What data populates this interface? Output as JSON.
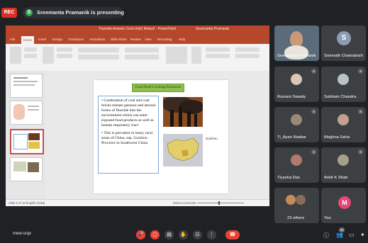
{
  "meet": {
    "rec_label": "REC",
    "presenter_initial": "S",
    "presenting_text": "Sreemanta Pramanik is presenting",
    "meeting_code": "mew-srqx"
  },
  "powerpoint": {
    "title_bar": "Fluoride-Arsenic Cont-Unit1 Notes2 - PowerPoint",
    "user": "Sreemanta Pramanik",
    "tabs": [
      "File",
      "Home",
      "Insert",
      "Design",
      "Transitions",
      "Animations",
      "Slide Show",
      "Review",
      "View",
      "Recording",
      "Help"
    ],
    "slide": {
      "title": "Coal-fired Cocking Emission",
      "bullets": [
        "• Combustion of coal and coal bricks release gaseous and aerosol forms of fluoride into the environment which can enter exposed food products as well as human respiratory tract",
        "• This is prevalent in many rural areas of China, esp. Guizhou Province in Southwest China"
      ],
      "map_label": "Guizhou"
    },
    "status_left": "Slide 5 of 18   English (India)",
    "status_right": "Notes   Comments"
  },
  "participants": [
    {
      "name": "Sreemanta Pramanik",
      "type": "camera"
    },
    {
      "name": "Somnath Chakraborti",
      "type": "avatar",
      "initial": "S",
      "color": "#8e9bb5"
    },
    {
      "name": "Rumani Swasty",
      "type": "photo"
    },
    {
      "name": "Subham Chandra",
      "type": "photo"
    },
    {
      "name": "Ti_Ayan Naskar",
      "type": "photo"
    },
    {
      "name": "Meghna Saha",
      "type": "photo"
    },
    {
      "name": "Tiyasha Das",
      "type": "photo"
    },
    {
      "name": "Ankit K Shah",
      "type": "photo"
    },
    {
      "name": "23 others",
      "type": "others"
    },
    {
      "name": "You",
      "type": "avatar",
      "initial": "M",
      "color": "#e8457a"
    }
  ],
  "icons": {
    "mic": "mic-off-icon",
    "camera": "camera-off-icon",
    "captions": "captions-icon",
    "hand": "raise-hand-icon",
    "present": "present-icon",
    "more": "more-options-icon",
    "end": "end-call-icon",
    "info": "info-icon",
    "people": "people-icon",
    "chat": "chat-icon",
    "activities": "activities-icon"
  },
  "people_count": "33"
}
